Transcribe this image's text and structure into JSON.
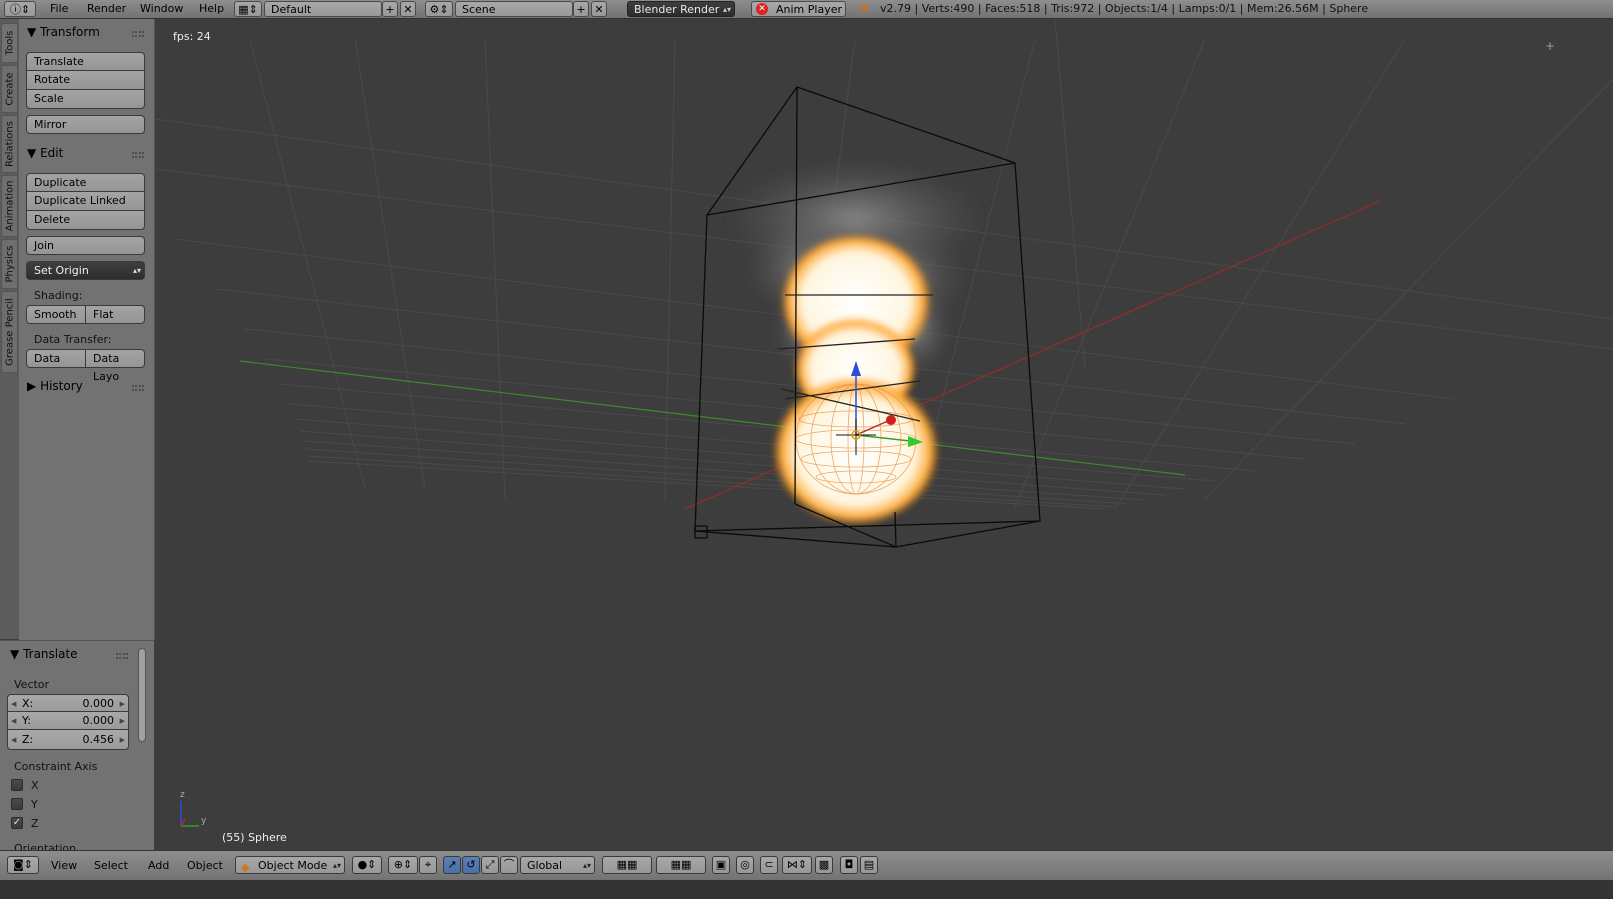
{
  "menu": {
    "file": "File",
    "render": "Render",
    "window": "Window",
    "help": "Help"
  },
  "layout_name": "Default",
  "scene_name": "Scene",
  "render_engine": "Blender Render",
  "anim_player": "Anim Player",
  "stats": "v2.79 | Verts:490 | Faces:518 | Tris:972 | Objects:1/4 | Lamps:0/1 | Mem:26.56M | Sphere",
  "tabs": [
    "Tools",
    "Create",
    "Relations",
    "Animation",
    "Physics",
    "Grease Pencil"
  ],
  "tool_shelf": {
    "transform": {
      "title": "Transform",
      "translate": "Translate",
      "rotate": "Rotate",
      "scale": "Scale",
      "mirror": "Mirror"
    },
    "edit": {
      "title": "Edit",
      "duplicate": "Duplicate",
      "duplicate_linked": "Duplicate Linked",
      "delete": "Delete",
      "join": "Join",
      "set_origin": "Set Origin"
    },
    "shading": {
      "label": "Shading:",
      "smooth": "Smooth",
      "flat": "Flat"
    },
    "data_transfer": {
      "label": "Data Transfer:",
      "data": "Data",
      "data_layout": "Data Layo"
    },
    "history": {
      "title": "History"
    }
  },
  "operator": {
    "title": "Translate",
    "vector_label": "Vector",
    "x_label": "X:",
    "x_value": "0.000",
    "y_label": "Y:",
    "y_value": "0.000",
    "z_label": "Z:",
    "z_value": "0.456",
    "constraint_label": "Constraint Axis",
    "axis_x": "X",
    "axis_y": "Y",
    "axis_z": "Z",
    "axis_x_checked": false,
    "axis_y_checked": false,
    "axis_z_checked": true,
    "orientation_label": "Orientation"
  },
  "viewport": {
    "fps": "fps: 24",
    "object_info": "(55) Sphere",
    "axis_z": "z",
    "axis_y": "y"
  },
  "bottom": {
    "view": "View",
    "select": "Select",
    "add": "Add",
    "object": "Object",
    "mode": "Object Mode",
    "orientation": "Global"
  },
  "colors": {
    "viewport_bg": "#3d3d3d",
    "header_bg": "#727272",
    "x_axis": "#b32b2b",
    "y_axis": "#3a9a2a",
    "z_axis": "#2a4fd6",
    "accent_blue": "#5680c2"
  }
}
